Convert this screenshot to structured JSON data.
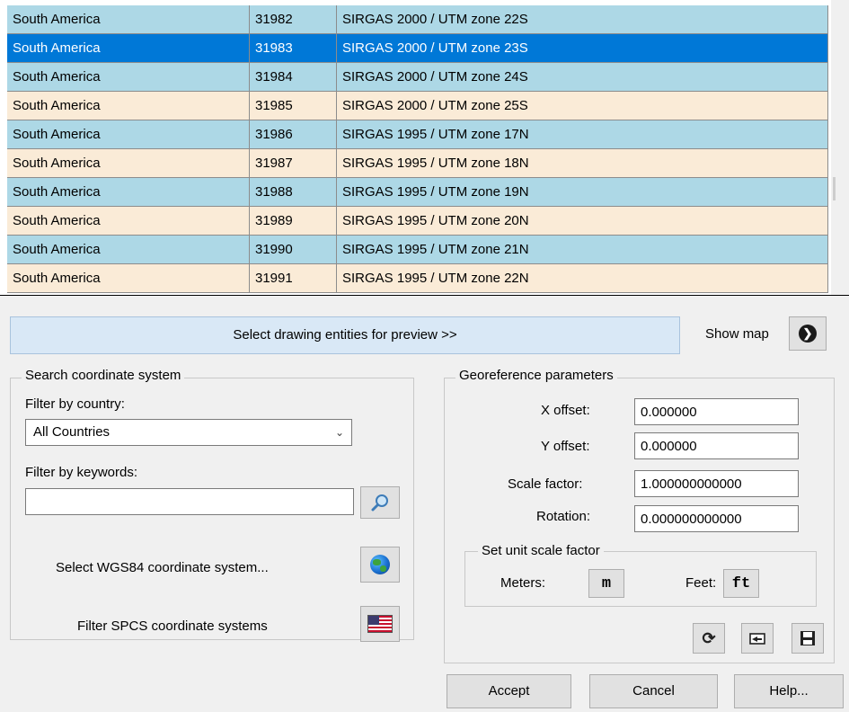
{
  "table": {
    "rows": [
      {
        "region": "South America",
        "code": "31982",
        "name": "SIRGAS 2000 / UTM zone 22S"
      },
      {
        "region": "South America",
        "code": "31983",
        "name": "SIRGAS 2000 / UTM zone 23S"
      },
      {
        "region": "South America",
        "code": "31984",
        "name": "SIRGAS 2000 / UTM zone 24S"
      },
      {
        "region": "South America",
        "code": "31985",
        "name": "SIRGAS 2000 / UTM zone 25S"
      },
      {
        "region": "South America",
        "code": "31986",
        "name": "SIRGAS 1995 / UTM zone 17N"
      },
      {
        "region": "South America",
        "code": "31987",
        "name": "SIRGAS 1995 / UTM zone 18N"
      },
      {
        "region": "South America",
        "code": "31988",
        "name": "SIRGAS 1995 / UTM zone 19N"
      },
      {
        "region": "South America",
        "code": "31989",
        "name": "SIRGAS 1995 / UTM zone 20N"
      },
      {
        "region": "South America",
        "code": "31990",
        "name": "SIRGAS 1995 / UTM zone 21N"
      },
      {
        "region": "South America",
        "code": "31991",
        "name": "SIRGAS 1995 / UTM zone 22N"
      }
    ],
    "selected_code": "31983",
    "colors": {
      "row_even": "#add8e6",
      "row_odd": "#faebd7",
      "selected": "#0078d7"
    }
  },
  "preview": {
    "select_entities_label": "Select drawing entities for preview >>",
    "show_map_label": "Show map",
    "show_map_icon": "circle-arrow-right-icon"
  },
  "search": {
    "legend": "Search coordinate system",
    "country_label": "Filter by country:",
    "country_value": "All Countries",
    "keywords_label": "Filter by keywords:",
    "keywords_value": "",
    "search_icon": "magnifier-icon",
    "wgs84_label": "Select WGS84 coordinate system...",
    "wgs84_icon": "globe-icon",
    "spcs_label": "Filter SPCS coordinate systems",
    "spcs_icon": "us-flag-icon"
  },
  "georef": {
    "legend": "Georeference parameters",
    "x_offset_label": "X offset:",
    "x_offset_value": "0.000000",
    "y_offset_label": "Y offset:",
    "y_offset_value": "0.000000",
    "scale_label": "Scale factor:",
    "scale_value": "1.000000000000",
    "rotation_label": "Rotation:",
    "rotation_value": "0.000000000000",
    "unit_legend": "Set unit scale factor",
    "meters_label": "Meters:",
    "meters_glyph": "m",
    "feet_label": "Feet:",
    "feet_glyph": "ft",
    "reset_icon": "refresh-icon",
    "load_icon": "load-icon",
    "save_icon": "floppy-disk-icon"
  },
  "dialog": {
    "accept": "Accept",
    "cancel": "Cancel",
    "help": "Help..."
  }
}
